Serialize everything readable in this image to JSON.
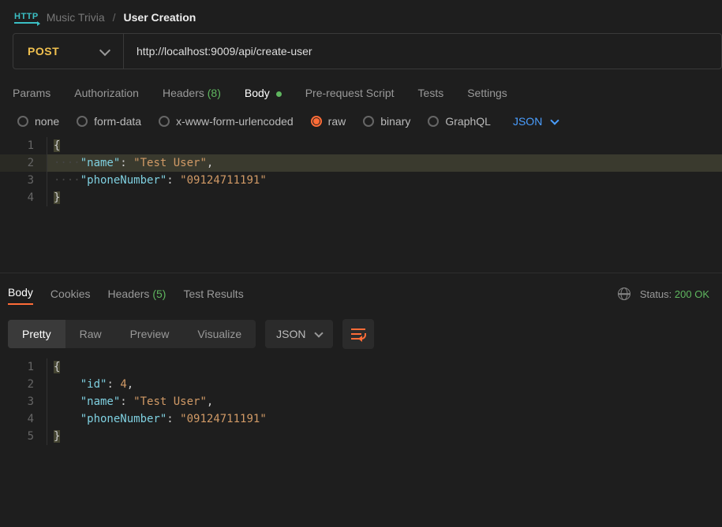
{
  "breadcrumb": {
    "collection": "Music Trivia",
    "item": "User Creation"
  },
  "request": {
    "method": "POST",
    "url": "http://localhost:9009/api/create-user",
    "tabs": {
      "params": "Params",
      "authorization": "Authorization",
      "headers_label": "Headers",
      "headers_count": "(8)",
      "body": "Body",
      "prerequest": "Pre-request Script",
      "tests": "Tests",
      "settings": "Settings"
    },
    "body_types": {
      "none": "none",
      "formdata": "form-data",
      "urlencoded": "x-www-form-urlencoded",
      "raw": "raw",
      "binary": "binary",
      "graphql": "GraphQL"
    },
    "format": "JSON",
    "body_json": {
      "name": "Test User",
      "phoneNumber": "09124711191"
    }
  },
  "response": {
    "tabs": {
      "body": "Body",
      "cookies": "Cookies",
      "headers_label": "Headers",
      "headers_count": "(5)",
      "tests": "Test Results"
    },
    "status_label": "Status:",
    "status_value": "200 OK",
    "views": {
      "pretty": "Pretty",
      "raw": "Raw",
      "preview": "Preview",
      "visualize": "Visualize"
    },
    "format": "JSON",
    "body_json": {
      "id": 4,
      "name": "Test User",
      "phoneNumber": "09124711191"
    }
  }
}
